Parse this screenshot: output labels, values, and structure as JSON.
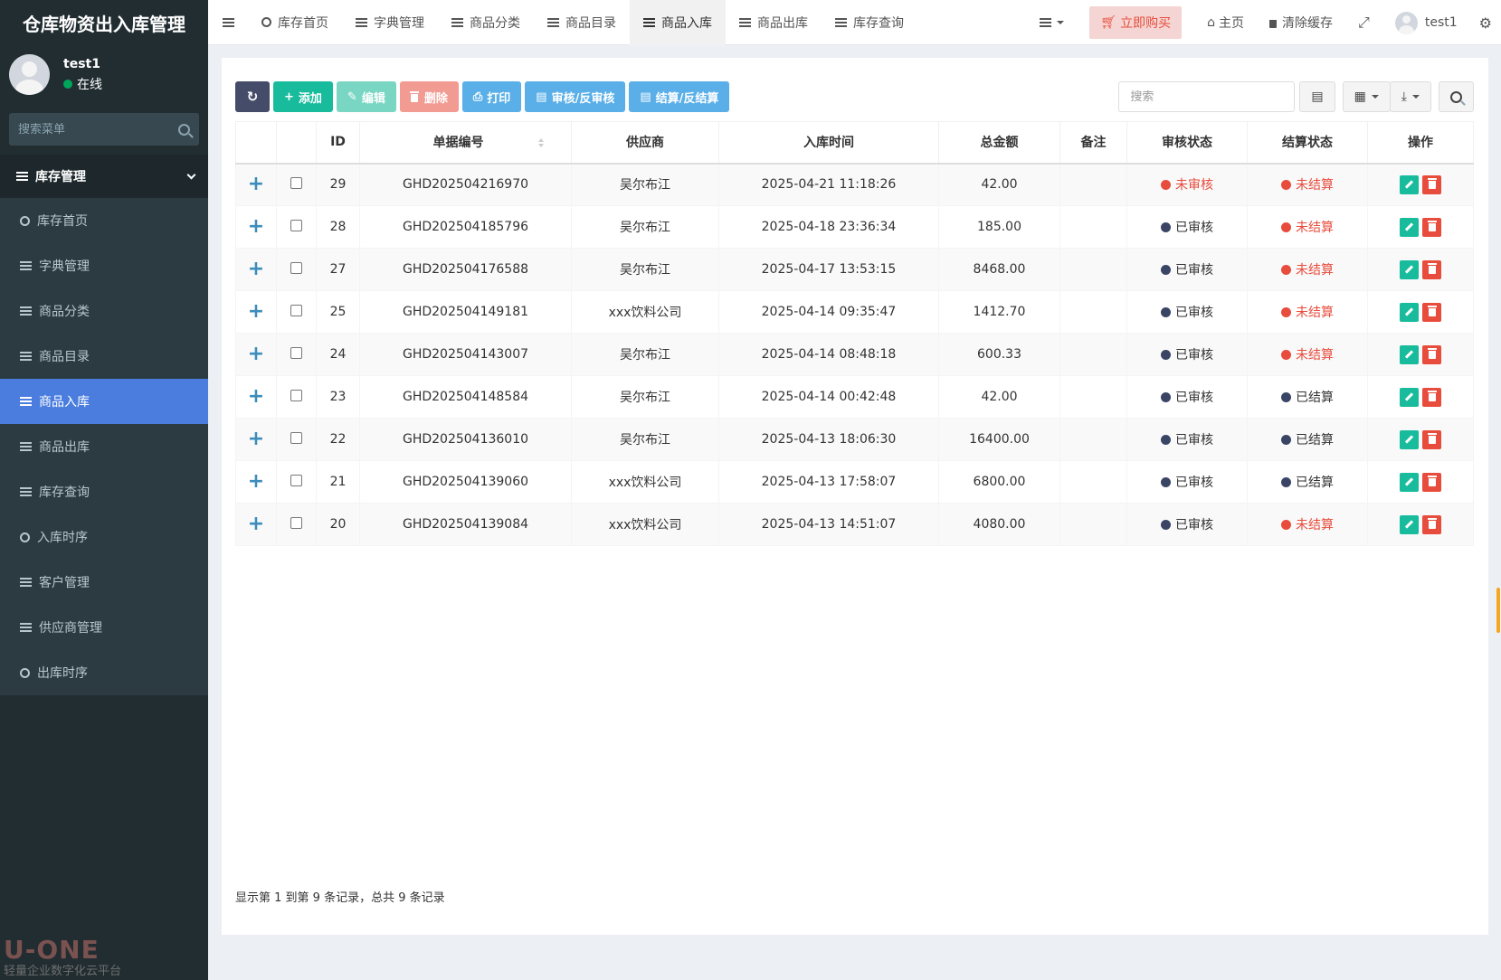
{
  "app": {
    "title": "仓库物资出入库管理"
  },
  "user": {
    "name": "test1",
    "status": "在线"
  },
  "sidebar": {
    "search_placeholder": "搜索菜单",
    "group_label": "库存管理",
    "items": [
      {
        "label": "库存首页",
        "icon": "circle-icon"
      },
      {
        "label": "字典管理",
        "icon": "list-icon"
      },
      {
        "label": "商品分类",
        "icon": "list-icon"
      },
      {
        "label": "商品目录",
        "icon": "list-icon"
      },
      {
        "label": "商品入库",
        "icon": "list-icon",
        "active": true
      },
      {
        "label": "商品出库",
        "icon": "list-icon"
      },
      {
        "label": "库存查询",
        "icon": "list-icon"
      },
      {
        "label": "入库时序",
        "icon": "circle-icon"
      },
      {
        "label": "客户管理",
        "icon": "list-icon"
      },
      {
        "label": "供应商管理",
        "icon": "list-icon"
      },
      {
        "label": "出库时序",
        "icon": "circle-icon"
      }
    ],
    "footer_logo": "U-ONE",
    "footer_sub": "轻量企业数字化云平台"
  },
  "navbar": {
    "tabs": [
      {
        "label": "库存首页",
        "icon": "circle-icon"
      },
      {
        "label": "字典管理",
        "icon": "list-icon"
      },
      {
        "label": "商品分类",
        "icon": "list-icon"
      },
      {
        "label": "商品目录",
        "icon": "list-icon"
      },
      {
        "label": "商品入库",
        "icon": "list-icon",
        "active": true
      },
      {
        "label": "商品出库",
        "icon": "list-icon"
      },
      {
        "label": "库存查询",
        "icon": "list-icon"
      }
    ],
    "buy_label": "立即购买",
    "home_label": "主页",
    "clear_cache_label": "清除缓存",
    "user_name": "test1"
  },
  "toolbar": {
    "add_label": "添加",
    "edit_label": "编辑",
    "delete_label": "删除",
    "print_label": "打印",
    "audit_label": "审核/反审核",
    "settle_label": "结算/反结算",
    "search_placeholder": "搜索"
  },
  "table": {
    "headers": [
      "",
      "",
      "ID",
      "单据编号",
      "供应商",
      "入库时间",
      "总金额",
      "备注",
      "审核状态",
      "结算状态",
      "操作"
    ],
    "rows": [
      {
        "id": "29",
        "code": "GHD202504216970",
        "supplier": "吴尔布江",
        "time": "2025-04-21 11:18:26",
        "amount": "42.00",
        "remark": "",
        "audit": "未审核",
        "settle": "未结算"
      },
      {
        "id": "28",
        "code": "GHD202504185796",
        "supplier": "吴尔布江",
        "time": "2025-04-18 23:36:34",
        "amount": "185.00",
        "remark": "",
        "audit": "已审核",
        "settle": "未结算"
      },
      {
        "id": "27",
        "code": "GHD202504176588",
        "supplier": "吴尔布江",
        "time": "2025-04-17 13:53:15",
        "amount": "8468.00",
        "remark": "",
        "audit": "已审核",
        "settle": "未结算"
      },
      {
        "id": "25",
        "code": "GHD202504149181",
        "supplier": "xxx饮料公司",
        "time": "2025-04-14 09:35:47",
        "amount": "1412.70",
        "remark": "",
        "audit": "已审核",
        "settle": "未结算"
      },
      {
        "id": "24",
        "code": "GHD202504143007",
        "supplier": "吴尔布江",
        "time": "2025-04-14 08:48:18",
        "amount": "600.33",
        "remark": "",
        "audit": "已审核",
        "settle": "未结算"
      },
      {
        "id": "23",
        "code": "GHD202504148584",
        "supplier": "吴尔布江",
        "time": "2025-04-14 00:42:48",
        "amount": "42.00",
        "remark": "",
        "audit": "已审核",
        "settle": "已结算"
      },
      {
        "id": "22",
        "code": "GHD202504136010",
        "supplier": "吴尔布江",
        "time": "2025-04-13 18:06:30",
        "amount": "16400.00",
        "remark": "",
        "audit": "已审核",
        "settle": "已结算"
      },
      {
        "id": "21",
        "code": "GHD202504139060",
        "supplier": "xxx饮料公司",
        "time": "2025-04-13 17:58:07",
        "amount": "6800.00",
        "remark": "",
        "audit": "已审核",
        "settle": "已结算"
      },
      {
        "id": "20",
        "code": "GHD202504139084",
        "supplier": "xxx饮料公司",
        "time": "2025-04-13 14:51:07",
        "amount": "4080.00",
        "remark": "",
        "audit": "已审核",
        "settle": "未结算"
      }
    ]
  },
  "pager": {
    "info": "显示第 1 到第 9 条记录，总共 9 条记录"
  },
  "colors": {
    "accent": "#4a7dde",
    "success": "#18bc9c",
    "danger": "#e74c3c",
    "sidebar": "#222d32"
  }
}
